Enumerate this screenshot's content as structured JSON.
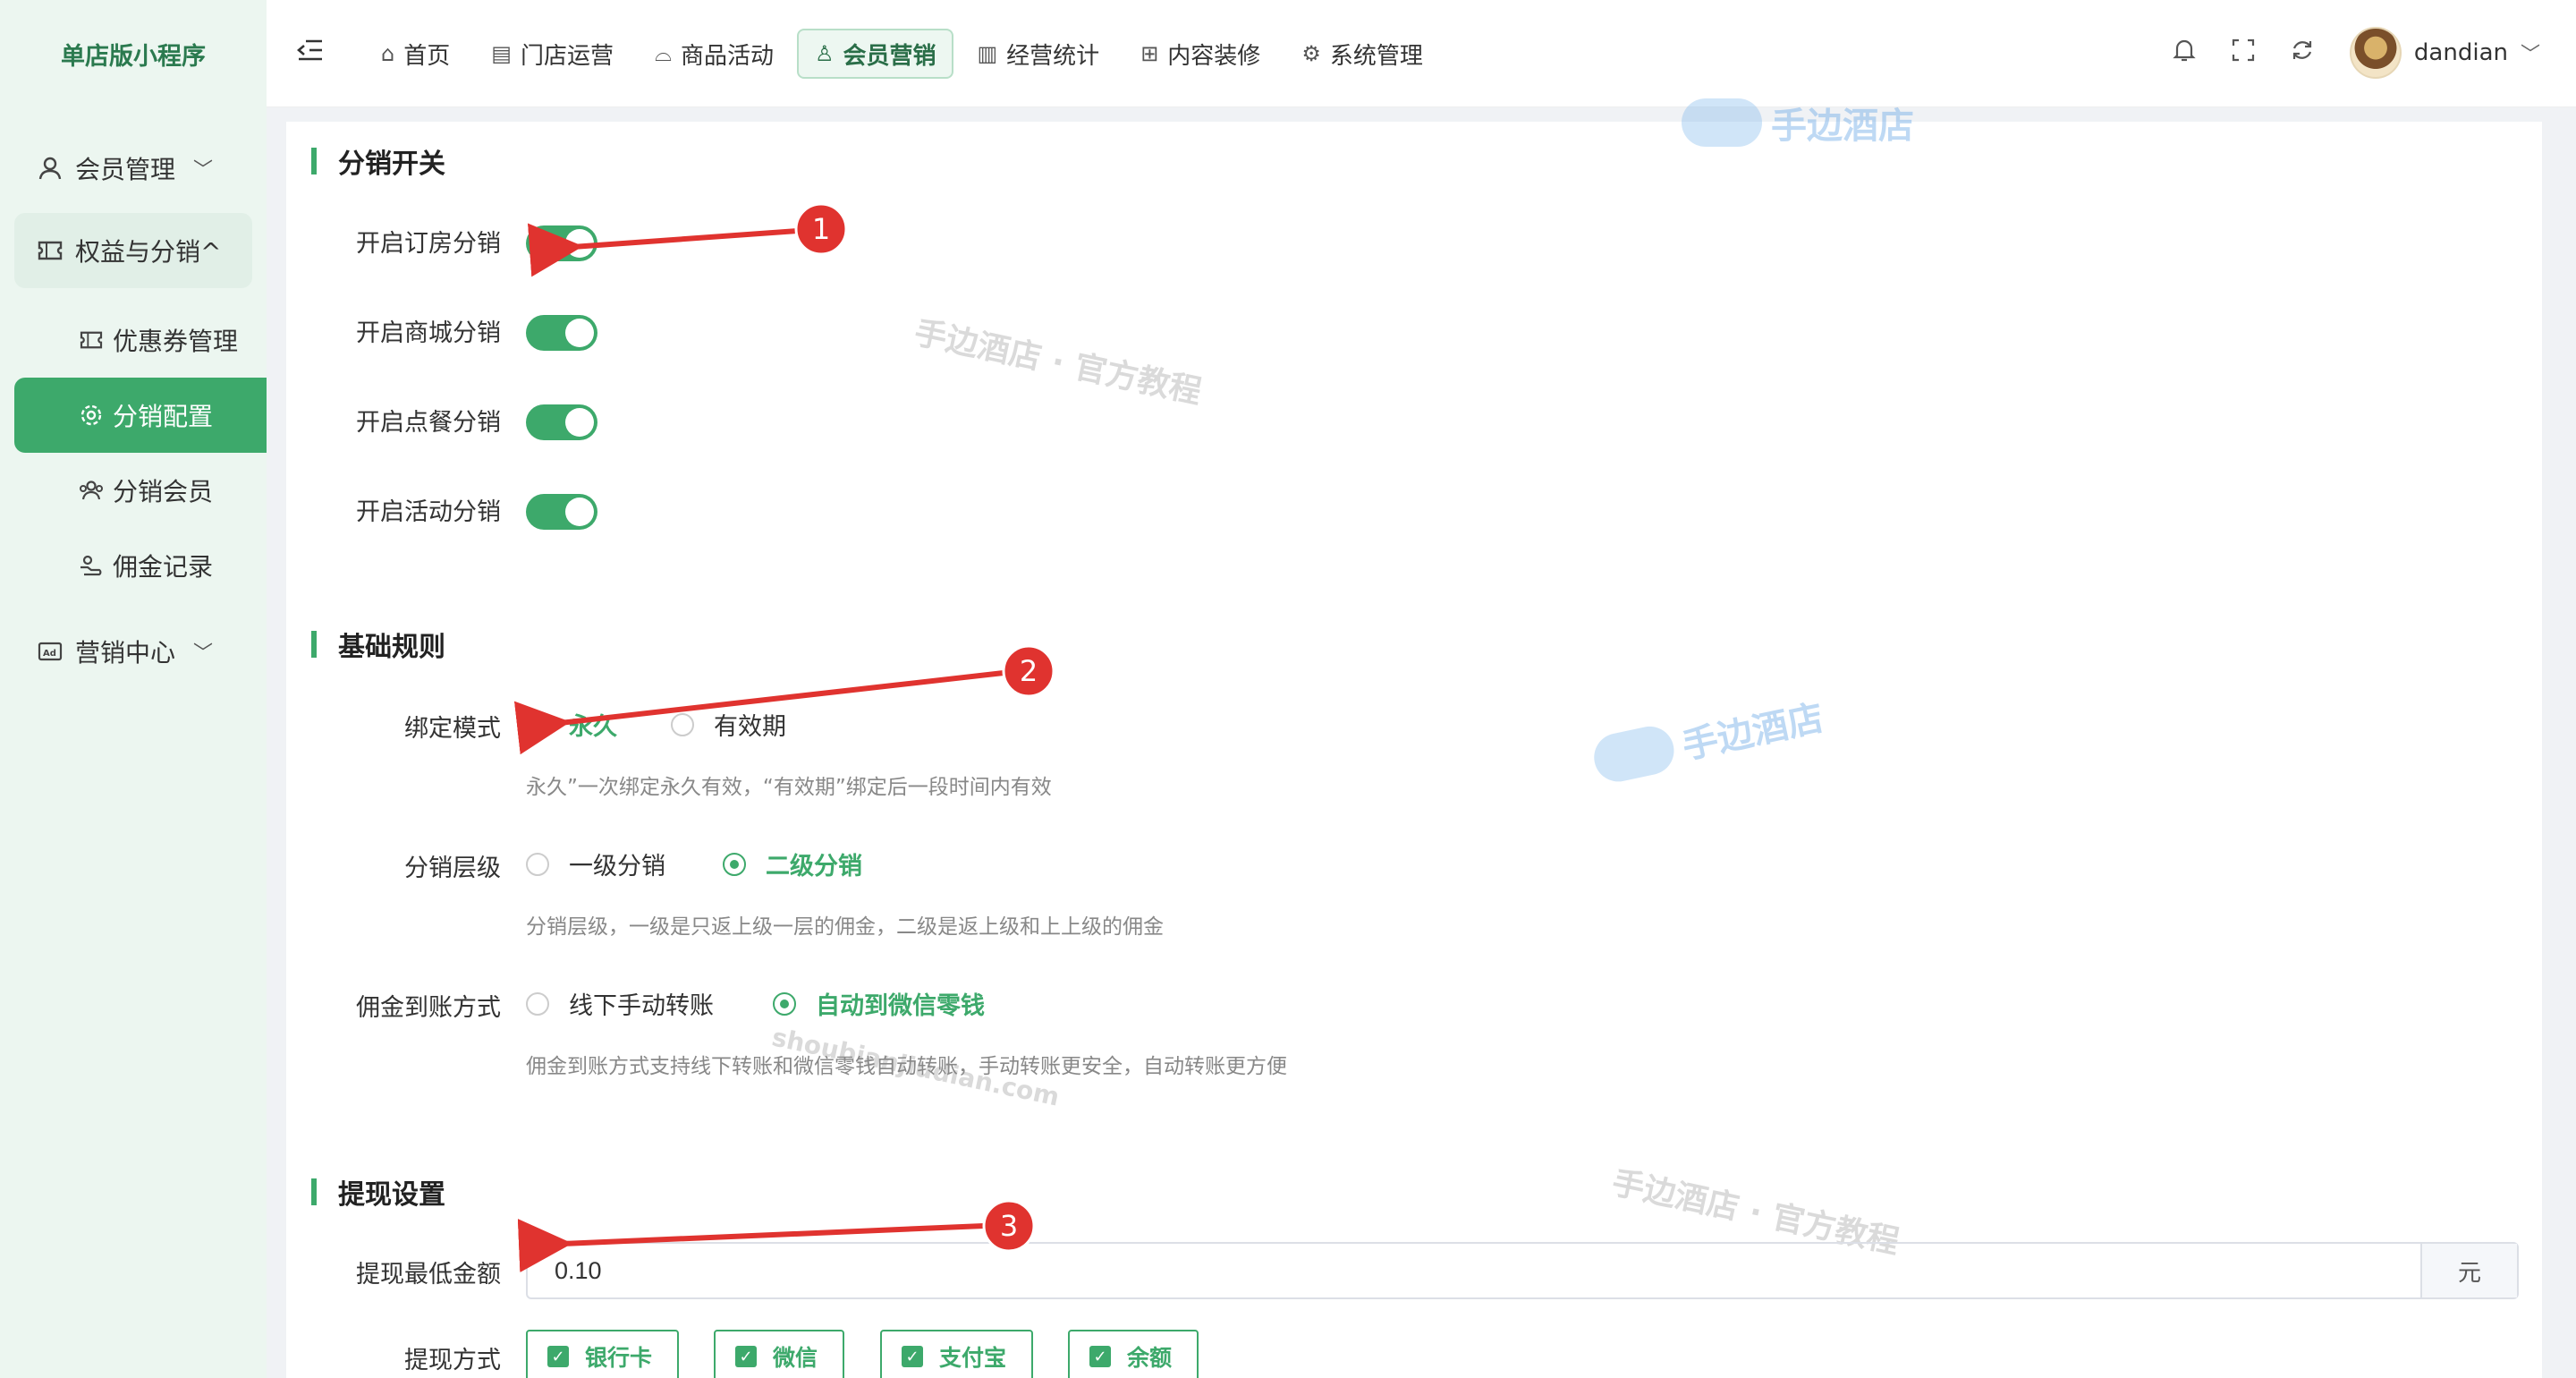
{
  "sidebar": {
    "logo": "单店版小程序",
    "items": [
      {
        "label": "会员管理",
        "icon": "user-icon"
      },
      {
        "label": "权益与分销^",
        "icon": "ticket-icon"
      },
      {
        "label": "优惠券管理",
        "icon": "coupon-icon"
      },
      {
        "label": "分销配置",
        "icon": "gear-icon"
      },
      {
        "label": "分销会员",
        "icon": "team-icon"
      },
      {
        "label": "佣金记录",
        "icon": "wallet-icon"
      },
      {
        "label": "营销中心",
        "icon": "ad-icon"
      }
    ]
  },
  "header": {
    "nav": [
      {
        "label": "首页",
        "icon": "home-icon"
      },
      {
        "label": "门店运营",
        "icon": "store-icon"
      },
      {
        "label": "商品活动",
        "icon": "shop-icon"
      },
      {
        "label": "会员营销",
        "icon": "member-icon"
      },
      {
        "label": "经营统计",
        "icon": "chart-icon"
      },
      {
        "label": "内容装修",
        "icon": "layout-icon"
      },
      {
        "label": "系统管理",
        "icon": "settings-icon"
      }
    ],
    "username": "dandian"
  },
  "switches": {
    "title": "分销开关",
    "items": [
      {
        "label": "开启订房分销",
        "on": true
      },
      {
        "label": "开启商城分销",
        "on": true
      },
      {
        "label": "开启点餐分销",
        "on": true
      },
      {
        "label": "开启活动分销",
        "on": true
      }
    ]
  },
  "rules": {
    "title": "基础规则",
    "bind_label": "绑定模式",
    "bind_opt1": "永久",
    "bind_opt2": "有效期",
    "bind_hint": "永久”一次绑定永久有效，“有效期”绑定后一段时间内有效",
    "level_label": "分销层级",
    "level_opt1": "一级分销",
    "level_opt2": "二级分销",
    "level_hint": "分销层级，一级是只返上级一层的佣金，二级是返上级和上上级的佣金",
    "pay_label": "佣金到账方式",
    "pay_opt1": "线下手动转账",
    "pay_opt2": "自动到微信零钱",
    "pay_hint": "佣金到账方式支持线下转账和微信零钱自动转账，手动转账更安全，自动转账更方便"
  },
  "withdraw": {
    "title": "提现设置",
    "min_label": "提现最低金额",
    "min_value": "0.10",
    "min_suffix": "元",
    "method_label": "提现方式",
    "methods": [
      "银行卡",
      "微信",
      "支付宝",
      "余额"
    ]
  },
  "watermarks": {
    "logo_text": "手边酒店",
    "tutorial": "手边酒店 · 官方教程",
    "domain": "shoubianjiudian.com"
  },
  "annotations": [
    "1",
    "2",
    "3"
  ],
  "colors": {
    "accent": "#3da96b",
    "arrow": "#e0332f"
  }
}
